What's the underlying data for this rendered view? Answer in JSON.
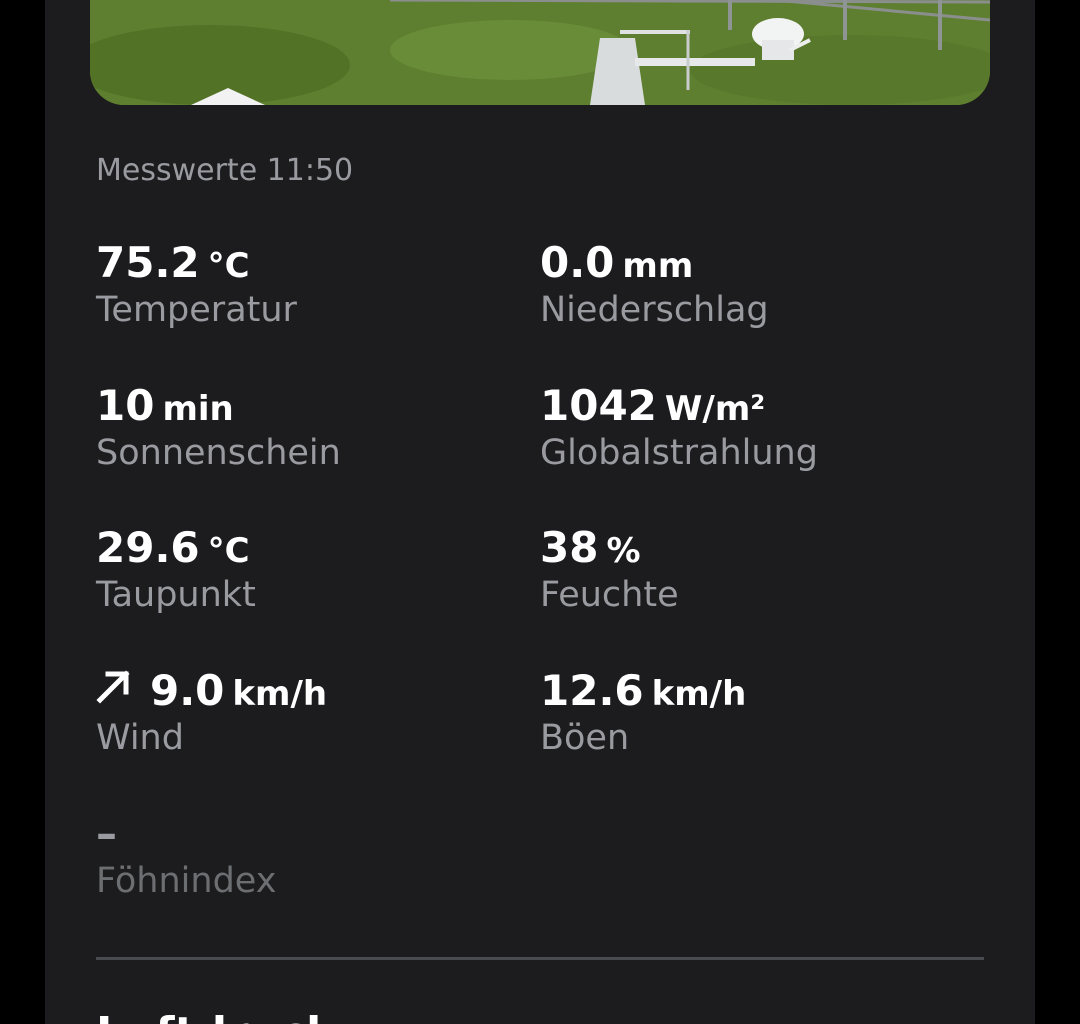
{
  "timestamp_label": "Messwerte 11:50",
  "metrics": {
    "temperatur": {
      "value": "75.2",
      "unit": "°C",
      "label": "Temperatur"
    },
    "niederschlag": {
      "value": "0.0",
      "unit": "mm",
      "label": "Niederschlag"
    },
    "sonnenschein": {
      "value": "10",
      "unit": "min",
      "label": "Sonnenschein"
    },
    "globalstrahlung": {
      "value": "1042",
      "unit": "W/m²",
      "label": "Globalstrahlung"
    },
    "taupunkt": {
      "value": "29.6",
      "unit": "°C",
      "label": "Taupunkt"
    },
    "feuchte": {
      "value": "38",
      "unit": "%",
      "label": "Feuchte"
    },
    "wind": {
      "value": "9.0",
      "unit": "km/h",
      "label": "Wind",
      "icon": "arrow-up-right-icon"
    },
    "boeen": {
      "value": "12.6",
      "unit": "km/h",
      "label": "Böen"
    },
    "foehnindex": {
      "value": "–",
      "label": "Föhnindex"
    }
  },
  "next_section_heading": "Luftdruck",
  "colors": {
    "background": "#000000",
    "panel": "#1c1c1f",
    "primary_text": "#ffffff",
    "secondary_text": "#9a9ba0",
    "divider": "#4a4b50"
  }
}
